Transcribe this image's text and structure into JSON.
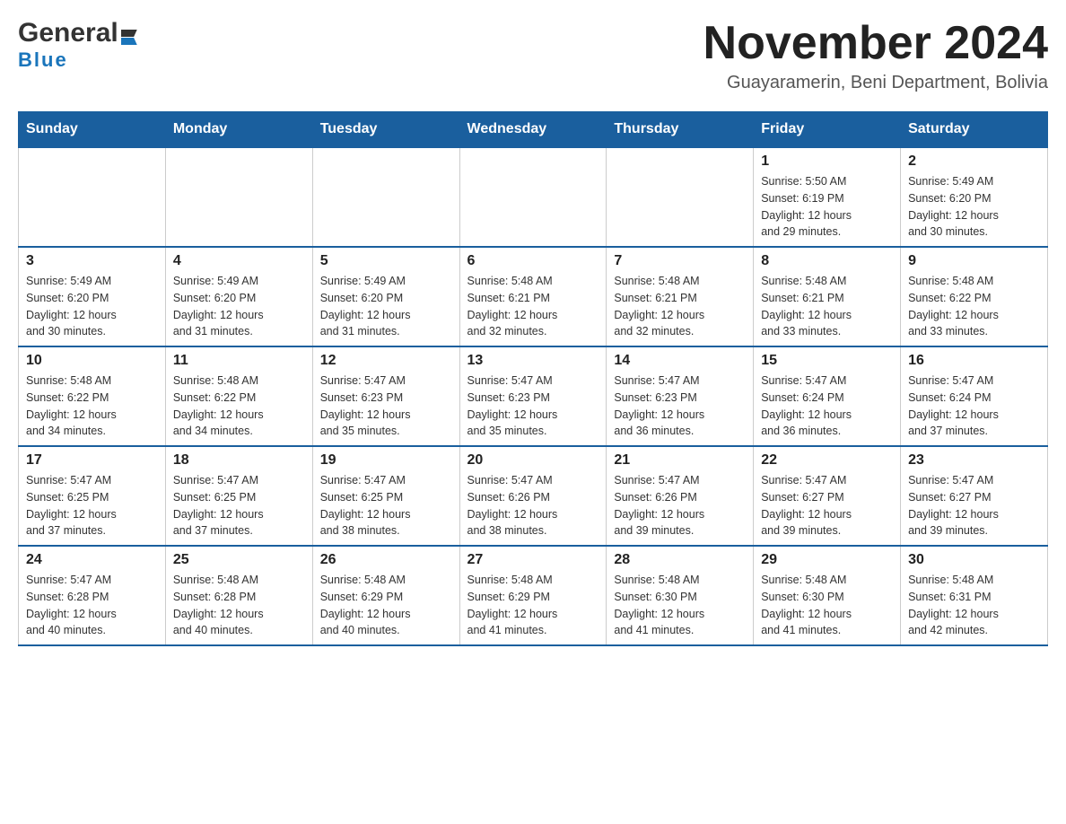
{
  "logo": {
    "text_general": "General",
    "text_blue": "Blue"
  },
  "header": {
    "month_year": "November 2024",
    "location": "Guayaramerin, Beni Department, Bolivia"
  },
  "weekdays": [
    "Sunday",
    "Monday",
    "Tuesday",
    "Wednesday",
    "Thursday",
    "Friday",
    "Saturday"
  ],
  "weeks": [
    [
      {
        "day": "",
        "info": ""
      },
      {
        "day": "",
        "info": ""
      },
      {
        "day": "",
        "info": ""
      },
      {
        "day": "",
        "info": ""
      },
      {
        "day": "",
        "info": ""
      },
      {
        "day": "1",
        "info": "Sunrise: 5:50 AM\nSunset: 6:19 PM\nDaylight: 12 hours\nand 29 minutes."
      },
      {
        "day": "2",
        "info": "Sunrise: 5:49 AM\nSunset: 6:20 PM\nDaylight: 12 hours\nand 30 minutes."
      }
    ],
    [
      {
        "day": "3",
        "info": "Sunrise: 5:49 AM\nSunset: 6:20 PM\nDaylight: 12 hours\nand 30 minutes."
      },
      {
        "day": "4",
        "info": "Sunrise: 5:49 AM\nSunset: 6:20 PM\nDaylight: 12 hours\nand 31 minutes."
      },
      {
        "day": "5",
        "info": "Sunrise: 5:49 AM\nSunset: 6:20 PM\nDaylight: 12 hours\nand 31 minutes."
      },
      {
        "day": "6",
        "info": "Sunrise: 5:48 AM\nSunset: 6:21 PM\nDaylight: 12 hours\nand 32 minutes."
      },
      {
        "day": "7",
        "info": "Sunrise: 5:48 AM\nSunset: 6:21 PM\nDaylight: 12 hours\nand 32 minutes."
      },
      {
        "day": "8",
        "info": "Sunrise: 5:48 AM\nSunset: 6:21 PM\nDaylight: 12 hours\nand 33 minutes."
      },
      {
        "day": "9",
        "info": "Sunrise: 5:48 AM\nSunset: 6:22 PM\nDaylight: 12 hours\nand 33 minutes."
      }
    ],
    [
      {
        "day": "10",
        "info": "Sunrise: 5:48 AM\nSunset: 6:22 PM\nDaylight: 12 hours\nand 34 minutes."
      },
      {
        "day": "11",
        "info": "Sunrise: 5:48 AM\nSunset: 6:22 PM\nDaylight: 12 hours\nand 34 minutes."
      },
      {
        "day": "12",
        "info": "Sunrise: 5:47 AM\nSunset: 6:23 PM\nDaylight: 12 hours\nand 35 minutes."
      },
      {
        "day": "13",
        "info": "Sunrise: 5:47 AM\nSunset: 6:23 PM\nDaylight: 12 hours\nand 35 minutes."
      },
      {
        "day": "14",
        "info": "Sunrise: 5:47 AM\nSunset: 6:23 PM\nDaylight: 12 hours\nand 36 minutes."
      },
      {
        "day": "15",
        "info": "Sunrise: 5:47 AM\nSunset: 6:24 PM\nDaylight: 12 hours\nand 36 minutes."
      },
      {
        "day": "16",
        "info": "Sunrise: 5:47 AM\nSunset: 6:24 PM\nDaylight: 12 hours\nand 37 minutes."
      }
    ],
    [
      {
        "day": "17",
        "info": "Sunrise: 5:47 AM\nSunset: 6:25 PM\nDaylight: 12 hours\nand 37 minutes."
      },
      {
        "day": "18",
        "info": "Sunrise: 5:47 AM\nSunset: 6:25 PM\nDaylight: 12 hours\nand 37 minutes."
      },
      {
        "day": "19",
        "info": "Sunrise: 5:47 AM\nSunset: 6:25 PM\nDaylight: 12 hours\nand 38 minutes."
      },
      {
        "day": "20",
        "info": "Sunrise: 5:47 AM\nSunset: 6:26 PM\nDaylight: 12 hours\nand 38 minutes."
      },
      {
        "day": "21",
        "info": "Sunrise: 5:47 AM\nSunset: 6:26 PM\nDaylight: 12 hours\nand 39 minutes."
      },
      {
        "day": "22",
        "info": "Sunrise: 5:47 AM\nSunset: 6:27 PM\nDaylight: 12 hours\nand 39 minutes."
      },
      {
        "day": "23",
        "info": "Sunrise: 5:47 AM\nSunset: 6:27 PM\nDaylight: 12 hours\nand 39 minutes."
      }
    ],
    [
      {
        "day": "24",
        "info": "Sunrise: 5:47 AM\nSunset: 6:28 PM\nDaylight: 12 hours\nand 40 minutes."
      },
      {
        "day": "25",
        "info": "Sunrise: 5:48 AM\nSunset: 6:28 PM\nDaylight: 12 hours\nand 40 minutes."
      },
      {
        "day": "26",
        "info": "Sunrise: 5:48 AM\nSunset: 6:29 PM\nDaylight: 12 hours\nand 40 minutes."
      },
      {
        "day": "27",
        "info": "Sunrise: 5:48 AM\nSunset: 6:29 PM\nDaylight: 12 hours\nand 41 minutes."
      },
      {
        "day": "28",
        "info": "Sunrise: 5:48 AM\nSunset: 6:30 PM\nDaylight: 12 hours\nand 41 minutes."
      },
      {
        "day": "29",
        "info": "Sunrise: 5:48 AM\nSunset: 6:30 PM\nDaylight: 12 hours\nand 41 minutes."
      },
      {
        "day": "30",
        "info": "Sunrise: 5:48 AM\nSunset: 6:31 PM\nDaylight: 12 hours\nand 42 minutes."
      }
    ]
  ]
}
